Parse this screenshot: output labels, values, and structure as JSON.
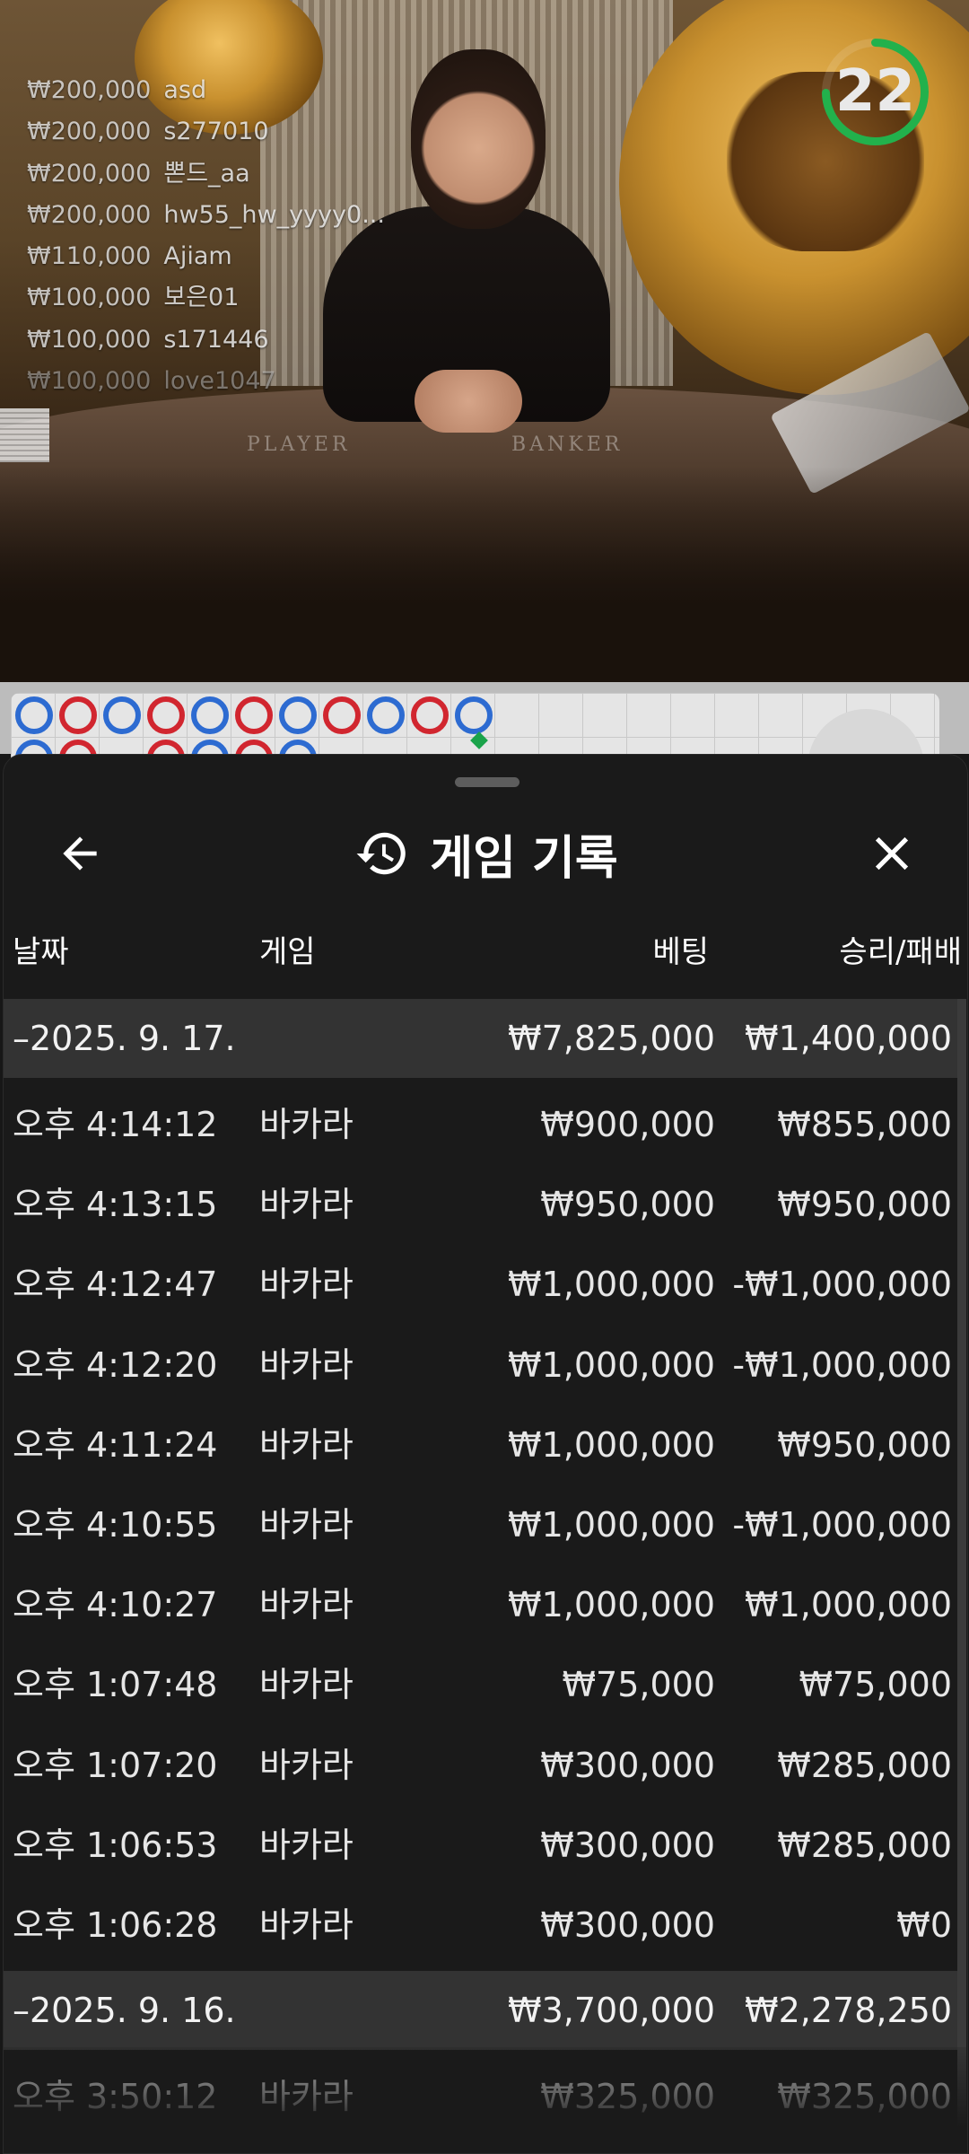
{
  "video": {
    "timer_value": "22",
    "felt_labels": {
      "player": "PLAYER",
      "banker": "BANKER"
    },
    "timer_color": "#22b14c",
    "bet_feed": [
      {
        "amount": "₩200,000",
        "user": "asd"
      },
      {
        "amount": "₩200,000",
        "user": "s277010"
      },
      {
        "amount": "₩200,000",
        "user": "뽄드_aa"
      },
      {
        "amount": "₩200,000",
        "user": "hw55_hw_yyyy0..."
      },
      {
        "amount": "₩110,000",
        "user": "Ajiam"
      },
      {
        "amount": "₩100,000",
        "user": "보은01"
      },
      {
        "amount": "₩100,000",
        "user": "s171446"
      },
      {
        "amount": "₩100,000",
        "user": "love1047"
      }
    ]
  },
  "road": {
    "colors": {
      "player": "#2d6bd1",
      "banker": "#d1262f"
    },
    "row1": [
      "blue",
      "red",
      "blue",
      "red",
      "blue",
      "red",
      "blue",
      "red",
      "blue",
      "red",
      "blue"
    ],
    "row2": [
      "blue",
      "red",
      "",
      "red",
      "blue",
      "red",
      "blue",
      "",
      "",
      "",
      "green-mark"
    ]
  },
  "sheet": {
    "title": "게임 기록",
    "icons": {
      "back": "back-arrow-icon",
      "history": "history-icon",
      "close": "close-icon"
    },
    "columns": {
      "date": "날짜",
      "game": "게임",
      "bet": "베팅",
      "result": "승리/패배"
    },
    "groups": [
      {
        "date": "2025. 9. 17.",
        "collapse_marker": "–",
        "total_bet": "₩7,825,000",
        "total_result": "₩1,400,000",
        "rows": [
          {
            "time": "오후 4:14:12",
            "game": "바카라",
            "bet": "₩900,000",
            "result": "₩855,000"
          },
          {
            "time": "오후 4:13:15",
            "game": "바카라",
            "bet": "₩950,000",
            "result": "₩950,000"
          },
          {
            "time": "오후 4:12:47",
            "game": "바카라",
            "bet": "₩1,000,000",
            "result": "-₩1,000,000"
          },
          {
            "time": "오후 4:12:20",
            "game": "바카라",
            "bet": "₩1,000,000",
            "result": "-₩1,000,000"
          },
          {
            "time": "오후 4:11:24",
            "game": "바카라",
            "bet": "₩1,000,000",
            "result": "₩950,000"
          },
          {
            "time": "오후 4:10:55",
            "game": "바카라",
            "bet": "₩1,000,000",
            "result": "-₩1,000,000"
          },
          {
            "time": "오후 4:10:27",
            "game": "바카라",
            "bet": "₩1,000,000",
            "result": "₩1,000,000"
          },
          {
            "time": "오후 1:07:48",
            "game": "바카라",
            "bet": "₩75,000",
            "result": "₩75,000"
          },
          {
            "time": "오후 1:07:20",
            "game": "바카라",
            "bet": "₩300,000",
            "result": "₩285,000"
          },
          {
            "time": "오후 1:06:53",
            "game": "바카라",
            "bet": "₩300,000",
            "result": "₩285,000"
          },
          {
            "time": "오후 1:06:28",
            "game": "바카라",
            "bet": "₩300,000",
            "result": "₩0"
          }
        ]
      },
      {
        "date": "2025. 9. 16.",
        "collapse_marker": "–",
        "total_bet": "₩3,700,000",
        "total_result": "₩2,278,250",
        "rows": [
          {
            "time": "오후 3:50:12",
            "game": "바카라",
            "bet": "₩325,000",
            "result": "₩325,000"
          }
        ]
      }
    ]
  }
}
